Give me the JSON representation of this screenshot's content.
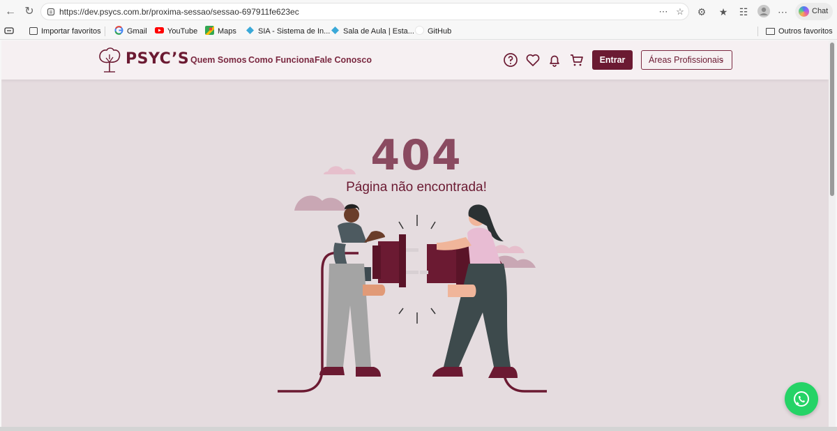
{
  "browser": {
    "url": "https://dev.psycs.com.br/proxima-sessao/sessao-697911fe623ec",
    "chat_label": "Chat"
  },
  "bookmarks": {
    "items": [
      {
        "label": "Importar favoritos",
        "icon": "import-icon"
      },
      {
        "label": "Gmail",
        "icon": "google-icon"
      },
      {
        "label": "YouTube",
        "icon": "youtube-icon"
      },
      {
        "label": "Maps",
        "icon": "maps-icon"
      },
      {
        "label": "SIA - Sistema de In...",
        "icon": "diamond-icon"
      },
      {
        "label": "Sala de Aula | Esta...",
        "icon": "diamond-icon"
      },
      {
        "label": "GitHub",
        "icon": "github-icon"
      }
    ],
    "other_label": "Outros favoritos"
  },
  "site": {
    "logo": "PSYC’S",
    "nav": [
      "Quem Somos",
      "Como Funciona",
      "Fale Conosco"
    ],
    "login_label": "Entrar",
    "areas_label": "Áreas Profissionais",
    "brand_color": "#6b1a32"
  },
  "error": {
    "code": "404",
    "message": "Página não encontrada!"
  }
}
